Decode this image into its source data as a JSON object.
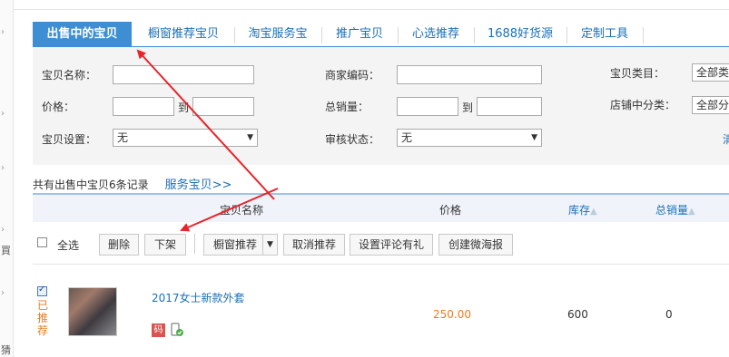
{
  "tabs": [
    {
      "label": "出售中的宝贝",
      "active": true
    },
    {
      "label": "橱窗推荐宝贝",
      "active": false
    },
    {
      "label": "淘宝服务宝",
      "active": false
    },
    {
      "label": "推广宝贝",
      "active": false
    },
    {
      "label": "心选推荐",
      "active": false
    },
    {
      "label": "1688好货源",
      "active": false
    },
    {
      "label": "定制工具",
      "active": false
    }
  ],
  "filters": {
    "item_name_label": "宝贝名称：",
    "merchant_code_label": "商家编码：",
    "category_label": "宝贝类目：",
    "category_value": "全部类",
    "price_label": "价格：",
    "price_to": "到",
    "total_sales_label": "总销量：",
    "sales_to": "到",
    "shop_category_label": "店铺中分类：",
    "shop_category_value": "全部分",
    "item_setting_label": "宝贝设置：",
    "item_setting_value": "无",
    "review_status_label": "审核状态：",
    "review_status_value": "无",
    "clear_label": "清"
  },
  "summary": {
    "text": "共有出售中宝贝6条记录",
    "service_link": "服务宝贝>>"
  },
  "table": {
    "headers": {
      "name": "宝贝名称",
      "price": "价格",
      "stock": "库存",
      "sales": "总销量"
    }
  },
  "actions": {
    "select_all": "全选",
    "delete": "删除",
    "delist": "下架",
    "window_recommend": "橱窗推荐",
    "cancel_recommend": "取消推荐",
    "review_gift": "设置评论有礼",
    "create_poster": "创建微海报"
  },
  "items": [
    {
      "title": "2017女士新款外套",
      "price": "250.00",
      "stock": "600",
      "sales": "0",
      "recommended": "已推荐",
      "code_badge": "码",
      "checked": true
    }
  ],
  "colors": {
    "accent": "#3d8ed3",
    "link": "#1a6fb8",
    "price": "#e67e22",
    "annotation": "#e8232a"
  },
  "sidebar_fragments": [
    "買",
    "猜"
  ]
}
